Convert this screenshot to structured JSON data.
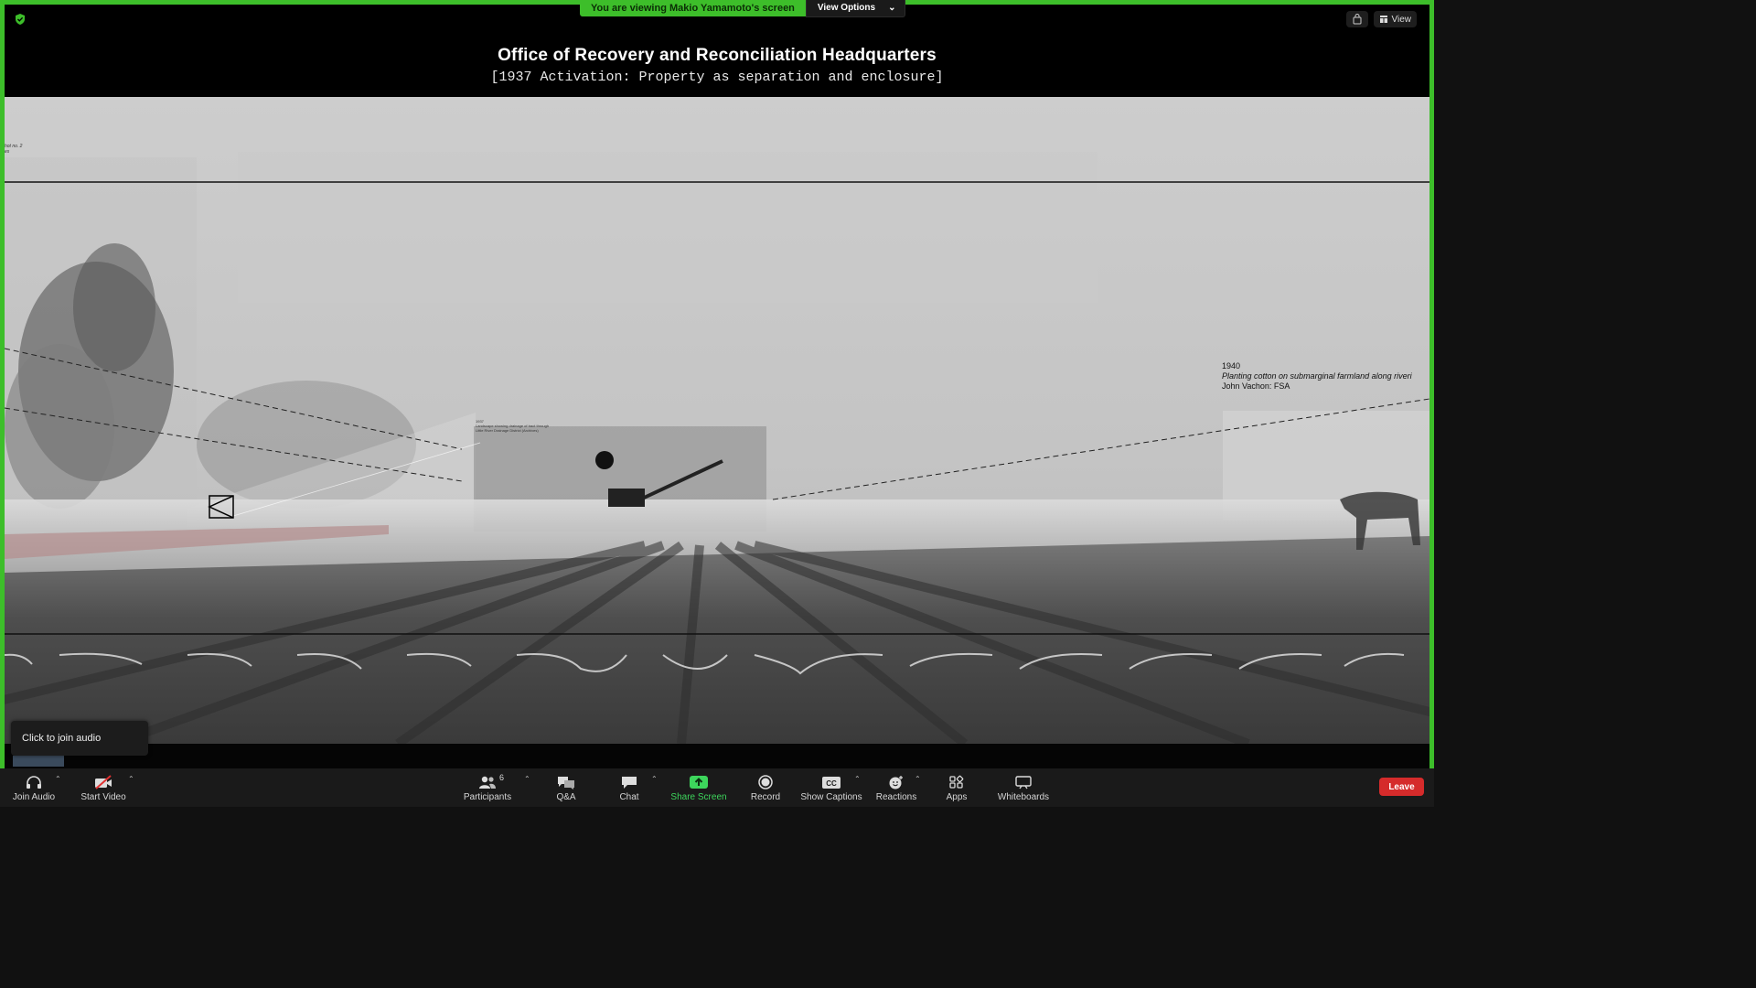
{
  "banner": {
    "viewing_text": "You are viewing Makio Yamamoto's screen",
    "view_options_label": "View Options"
  },
  "top_right": {
    "view_label": "View"
  },
  "slide": {
    "title": "Office of Recovery and Reconciliation  Headquarters",
    "subtitle": "[1937 Activation: Property as separation and enclosure]",
    "caption_1940": {
      "year": "1940",
      "description": "Planting cotton on submarginal farmland along riveri",
      "credit": "John Vachon: FSA"
    },
    "caption_1937": {
      "year": "1937",
      "line1": "Landscape showing drainage of tract through",
      "line2": "Little River Drainage District (Archives)"
    },
    "caption_corner": {
      "line1": "hot no. 2",
      "line2": "es"
    }
  },
  "audio_popup": {
    "text": "Click to join audio"
  },
  "toolbar": {
    "join_audio": "Join Audio",
    "start_video": "Start Video",
    "participants": "Participants",
    "participants_count": "6",
    "qa": "Q&A",
    "chat": "Chat",
    "share_screen": "Share Screen",
    "record": "Record",
    "show_captions": "Show Captions",
    "reactions": "Reactions",
    "apps": "Apps",
    "whiteboards": "Whiteboards",
    "leave": "Leave"
  },
  "colors": {
    "share_border": "#3dbe2a",
    "leave": "#d52b2b",
    "share_icon": "#3dd65c"
  }
}
